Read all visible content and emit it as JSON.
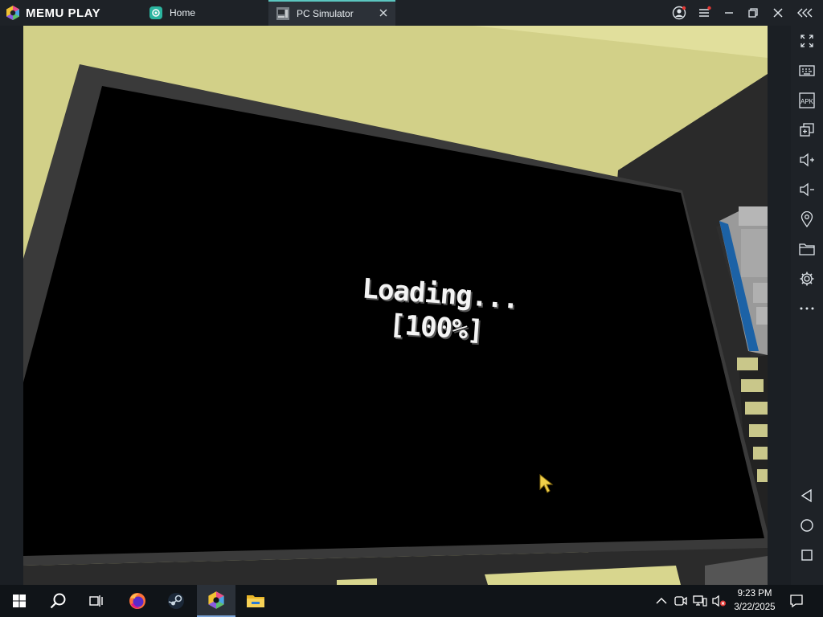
{
  "emulator": {
    "brand": "MEMU PLAY",
    "tabs": [
      {
        "label": "Home",
        "icon": "home-app-icon",
        "active": false
      },
      {
        "label": "PC Simulator",
        "icon": "pc-simulator-app-icon",
        "active": true
      }
    ],
    "window_controls": [
      "account-icon",
      "menu-icon",
      "minimize-icon",
      "restore-icon",
      "close-icon",
      "collapse-sidebar-icon"
    ],
    "sidebar_tools": [
      "fullscreen-icon",
      "keyboard-mapping-icon",
      "apk-install-icon",
      "multi-instance-icon",
      "volume-up-icon",
      "volume-down-icon",
      "location-icon",
      "shared-folder-icon",
      "settings-icon",
      "more-icon"
    ],
    "sidebar_nav": [
      "back-icon",
      "home-icon",
      "recent-apps-icon"
    ],
    "sidebar_apk_text": "APK",
    "accent_color": "#5bc6c0"
  },
  "game": {
    "loading_label": "Loading...",
    "progress_text": "[100%]",
    "progress": 1.0,
    "wall_color": "#d2d088",
    "screen_color": "#000000"
  },
  "taskbar": {
    "apps": [
      "windows-start-icon",
      "search-icon",
      "task-view-icon",
      "firefox-icon",
      "steam-icon",
      "memu-icon",
      "file-explorer-icon"
    ],
    "active_app": "memu-icon",
    "tray": [
      "show-hidden-icons-chevron",
      "meet-now-icon",
      "network-icon",
      "volume-muted-icon"
    ],
    "time": "9:23 PM",
    "date": "3/22/2025",
    "notification": "notification-icon"
  }
}
